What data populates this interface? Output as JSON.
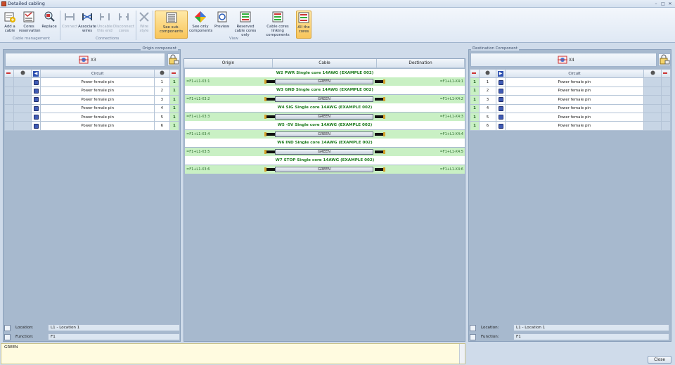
{
  "window": {
    "title": "Detailed cabling",
    "minimize": "–",
    "maximize": "□",
    "close": "✕"
  },
  "ribbon": {
    "cable_management": {
      "label": "Cable management",
      "add_cable": "Add a cable",
      "cores_reservation": "Cores reservation",
      "replace": "Replace"
    },
    "connections": {
      "label": "Connections",
      "connect": "Connect",
      "associate_wires": "Associate wires",
      "uncable_end": "Uncable this end",
      "disconnect_cores": "Disconnect cores",
      "wire_style": "Wire style"
    },
    "view": {
      "label": "View",
      "see_sub_components": "See sub-components",
      "see_only_components": "See only components",
      "preview": "Preview",
      "reserved_cable_cores_only": "Reserved cable cores only",
      "cable_cores_linking_components": "Cable cores linking components",
      "all_the_cores": "All the cores"
    }
  },
  "origin": {
    "panel_label": "Origin component",
    "component_name": "X3",
    "column_circuit": "Circuit",
    "rows": [
      {
        "circuit": "Power female pin",
        "num": "1",
        "status": "1"
      },
      {
        "circuit": "Power female pin",
        "num": "2",
        "status": "1"
      },
      {
        "circuit": "Power female pin",
        "num": "3",
        "status": "1"
      },
      {
        "circuit": "Power female pin",
        "num": "4",
        "status": "1"
      },
      {
        "circuit": "Power female pin",
        "num": "5",
        "status": "1"
      },
      {
        "circuit": "Power female pin",
        "num": "6",
        "status": "1"
      }
    ],
    "location_label": "Location:",
    "location_value": "L1 - Location 1",
    "function_label": "Function:",
    "function_value": "F1"
  },
  "cabling": {
    "col_origin": "Origin",
    "col_cable": "Cable",
    "col_destination": "Destination",
    "cables": [
      {
        "title": "W2   PWR   Single core 14AWG (EXAMPLE 002)",
        "origin": "=F1+L1-X3:1",
        "wire": "GREEN",
        "destination": "=F1+L1-X4:1"
      },
      {
        "title": "W3   GND   Single core 14AWG (EXAMPLE 002)",
        "origin": "=F1+L1-X3:2",
        "wire": "GREEN",
        "destination": "=F1+L1-X4:2"
      },
      {
        "title": "W4   SIG   Single core 14AWG (EXAMPLE 002)",
        "origin": "=F1+L1-X3:3",
        "wire": "GREEN",
        "destination": "=F1+L1-X4:3"
      },
      {
        "title": "W5   -5V   Single core 14AWG (EXAMPLE 002)",
        "origin": "=F1+L1-X3:4",
        "wire": "GREEN",
        "destination": "=F1+L1-X4:4"
      },
      {
        "title": "W6   IND   Single core 14AWG (EXAMPLE 002)",
        "origin": "=F1+L1-X3:5",
        "wire": "GREEN",
        "destination": "=F1+L1-X4:5"
      },
      {
        "title": "W7   STOP   Single core 14AWG (EXAMPLE 002)",
        "origin": "=F1+L1-X3:6",
        "wire": "GREEN",
        "destination": "=F1+L1-X4:6"
      }
    ]
  },
  "destination": {
    "panel_label": "Destination Component",
    "component_name": "X4",
    "column_circuit": "Circuit",
    "rows": [
      {
        "status": "1",
        "num": "1",
        "circuit": "Power female pin"
      },
      {
        "status": "1",
        "num": "2",
        "circuit": "Power female pin"
      },
      {
        "status": "1",
        "num": "3",
        "circuit": "Power female pin"
      },
      {
        "status": "1",
        "num": "4",
        "circuit": "Power female pin"
      },
      {
        "status": "1",
        "num": "5",
        "circuit": "Power female pin"
      },
      {
        "status": "1",
        "num": "6",
        "circuit": "Power female pin"
      }
    ],
    "location_label": "Location:",
    "location_value": "L1 - Location 1",
    "function_label": "Function:",
    "function_value": "F1"
  },
  "description": {
    "text": "GREEN"
  },
  "footer": {
    "close_label": "Close"
  },
  "colors": {
    "accent": "#f8c55a",
    "row_green": "#c9f0c4",
    "cable_text": "#1c7a1c"
  }
}
